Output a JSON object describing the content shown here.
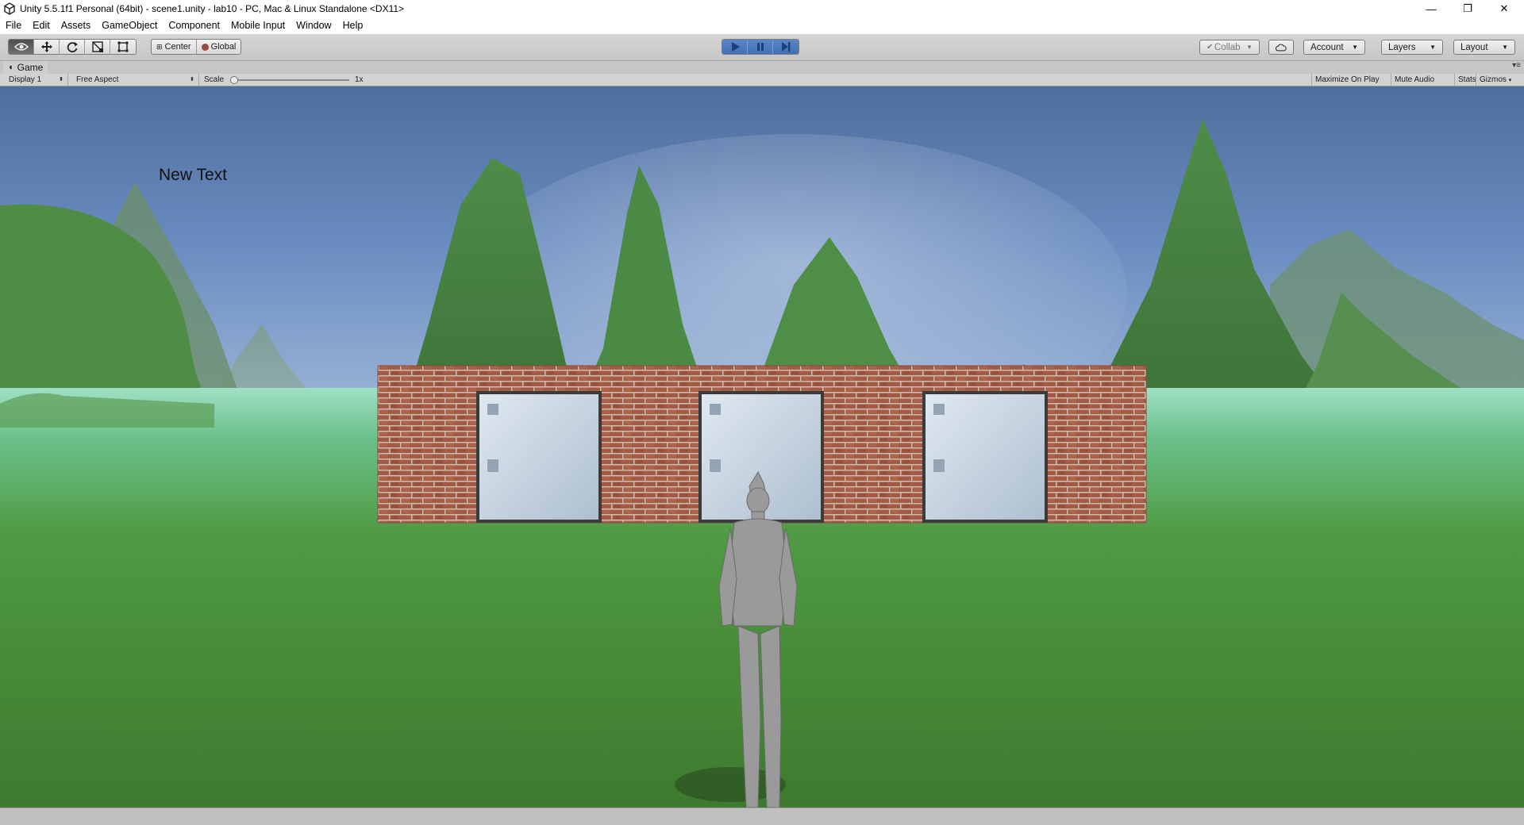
{
  "window": {
    "title": "Unity 5.5.1f1 Personal (64bit) - scene1.unity - lab10 - PC, Mac & Linux Standalone <DX11>",
    "minimize_glyph": "—",
    "restore_glyph": "❐",
    "close_glyph": "✕"
  },
  "menu": [
    "File",
    "Edit",
    "Assets",
    "GameObject",
    "Component",
    "Mobile Input",
    "Window",
    "Help"
  ],
  "toolbar": {
    "pivot_center": "Center",
    "pivot_global": "Global",
    "collab": "Collab",
    "account": "Account",
    "layers": "Layers",
    "layout": "Layout"
  },
  "game_tab": {
    "label": "Game",
    "menu_glyph": "▾≡"
  },
  "game_bar": {
    "display": "Display 1",
    "aspect": "Free Aspect",
    "scale_label": "Scale",
    "scale_value": "1x",
    "maximize": "Maximize On Play",
    "mute": "Mute Audio",
    "stats": "Stats",
    "gizmos": "Gizmos"
  },
  "scene": {
    "ui_text": "New Text"
  },
  "colors": {
    "play_active": "#3f6fb6",
    "brick": "#a85a44",
    "door_metal": "#c9d6e2",
    "grass": "#4f8a3d"
  }
}
